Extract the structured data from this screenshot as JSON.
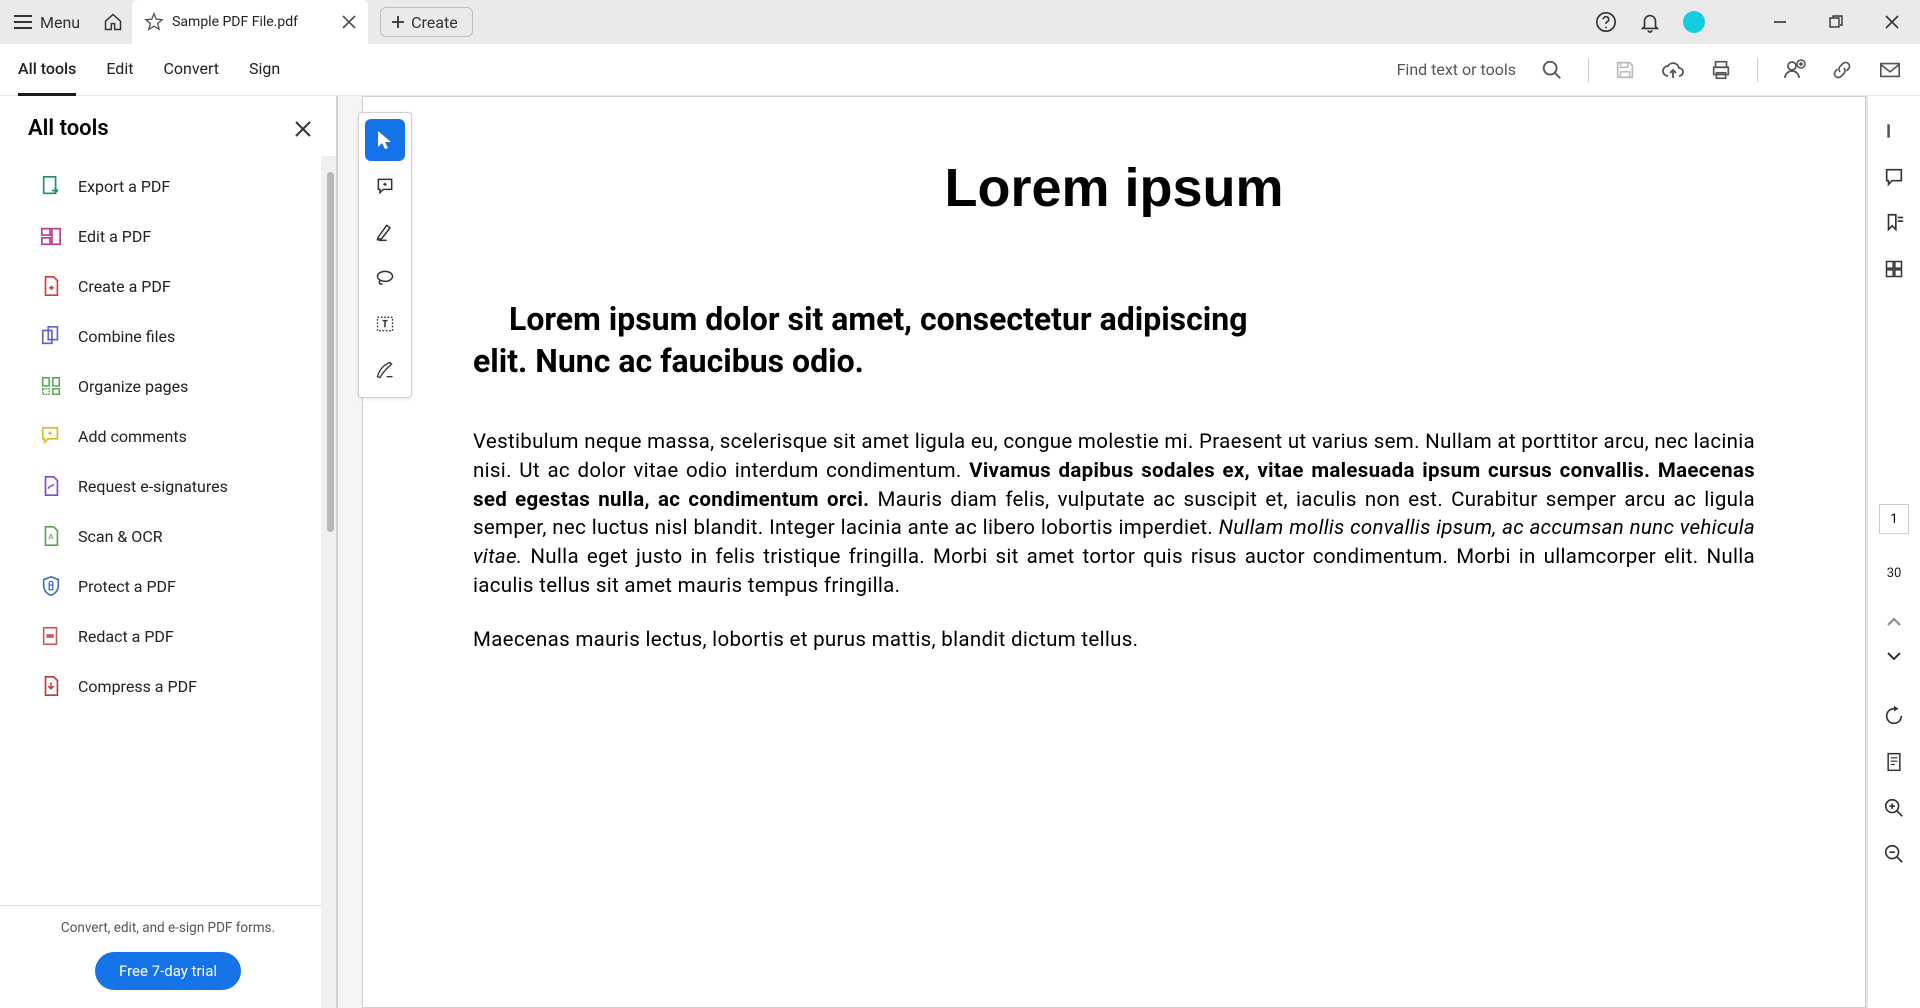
{
  "titlebar": {
    "menu_label": "Menu",
    "tab_label": "Sample PDF File.pdf",
    "create_label": "Create"
  },
  "toolbar": {
    "tabs": [
      "All tools",
      "Edit",
      "Convert",
      "Sign"
    ],
    "active_tab": 0,
    "search_label": "Find text or tools"
  },
  "sidebar": {
    "title": "All tools",
    "items": [
      {
        "label": "Export a PDF",
        "color": "#1e8f6e"
      },
      {
        "label": "Edit a PDF",
        "color": "#c0398b"
      },
      {
        "label": "Create a PDF",
        "color": "#dd3636"
      },
      {
        "label": "Combine files",
        "color": "#6363c5"
      },
      {
        "label": "Organize pages",
        "color": "#52a352"
      },
      {
        "label": "Add comments",
        "color": "#d4bd2c"
      },
      {
        "label": "Request e-signatures",
        "color": "#8049c9"
      },
      {
        "label": "Scan & OCR",
        "color": "#52a352"
      },
      {
        "label": "Protect a PDF",
        "color": "#3a6fc9"
      },
      {
        "label": "Redact a PDF",
        "color": "#c75a5a"
      },
      {
        "label": "Compress a PDF",
        "color": "#c23636"
      }
    ],
    "footer_text": "Convert, edit, and e-sign PDF forms.",
    "trial_label": "Free 7-day trial"
  },
  "document": {
    "title": "Lorem ipsum",
    "subtitle_line1": "Lorem ipsum dolor sit amet, consectetur adipiscing",
    "subtitle_line2": "elit. Nunc ac faucibus odio.",
    "para1_a": "Vestibulum neque massa, scelerisque sit amet ligula eu, congue molestie mi. Praesent ut varius sem. Nullam at porttitor arcu, nec lacinia nisi. Ut ac dolor vitae odio interdum condimentum. ",
    "para1_b": "Vivamus dapibus sodales ex, vitae malesuada ipsum cursus convallis. Maecenas sed egestas nulla, ac condimentum orci.",
    "para1_c": " Mauris diam felis, vulputate ac suscipit et, iaculis non est. Curabitur semper arcu ac ligula semper, nec luctus nisl blandit. Integer lacinia ante ac libero lobortis imperdiet. ",
    "para1_d": "Nullam mollis convallis ipsum, ac accumsan nunc vehicula vitae.",
    "para1_e": " Nulla eget justo in felis tristique fringilla. Morbi sit amet tortor quis risus auctor condimentum. Morbi in ullamcorper elit. Nulla iaculis tellus sit amet mauris tempus fringilla.",
    "para2": "Maecenas mauris lectus, lobortis et purus mattis, blandit dictum tellus."
  },
  "pages": {
    "current": "1",
    "total": "30"
  }
}
